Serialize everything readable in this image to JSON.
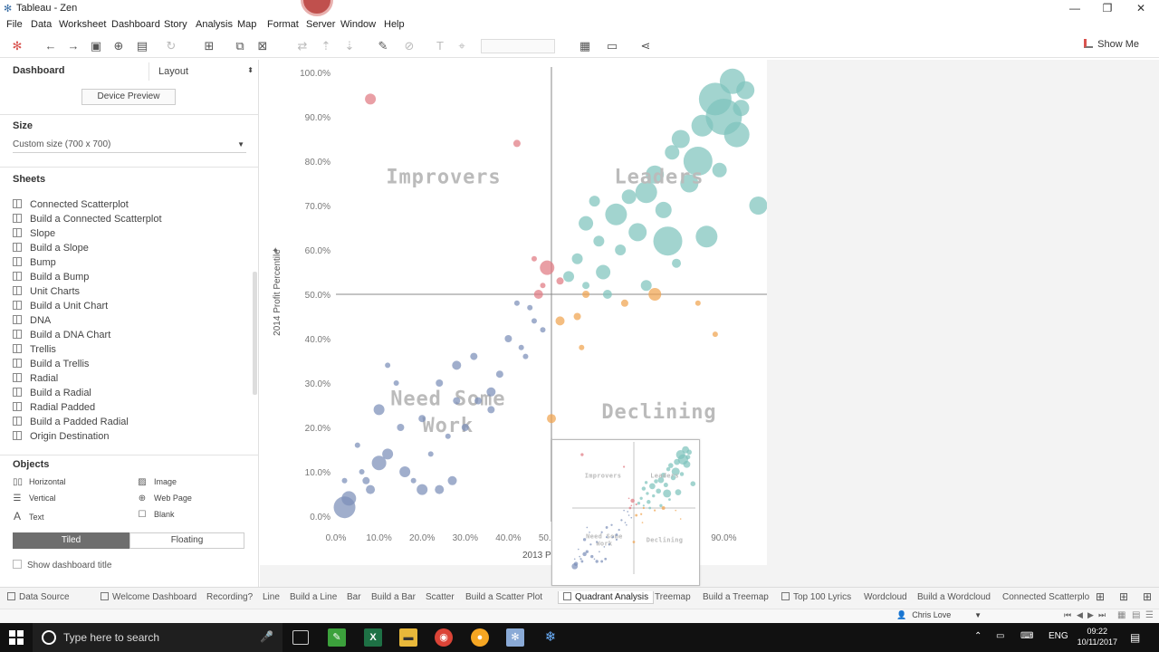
{
  "window": {
    "title": "Tableau - Zen",
    "minimize": "—",
    "restore": "❐",
    "close": "✕"
  },
  "menu": [
    "File",
    "Data",
    "Worksheet",
    "Dashboard",
    "Story",
    "Analysis",
    "Map",
    "Format",
    "Server",
    "Window",
    "Help"
  ],
  "toolbar": {
    "show_me": "Show Me"
  },
  "left_panel": {
    "tab_dashboard": "Dashboard",
    "tab_layout": "Layout",
    "device_preview": "Device Preview",
    "size_heading": "Size",
    "size_value": "Custom size (700 x 700)",
    "sheets_heading": "Sheets",
    "sheets": [
      "Connected Scatterplot",
      "Build a Connected Scatterplot",
      "Slope",
      "Build a Slope",
      "Bump",
      "Build a Bump",
      "Unit Charts",
      "Build a Unit Chart",
      "DNA",
      "Build a DNA Chart",
      "Trellis",
      "Build a Trellis",
      "Radial",
      "Build a Radial",
      "Radial Padded",
      "Build a Padded Radial",
      "Origin Destination"
    ],
    "objects_heading": "Objects",
    "objects": {
      "horizontal": "Horizontal",
      "image": "Image",
      "vertical": "Vertical",
      "web_page": "Web Page",
      "text": "Text",
      "blank": "Blank"
    },
    "tiled": "Tiled",
    "floating": "Floating",
    "show_title": "Show dashboard title"
  },
  "chart_data": {
    "type": "scatter",
    "xlabel": "2013 Profit Pe",
    "ylabel": "2014 Profit Percentile",
    "x_ticks": [
      "0.0%",
      "10.0%",
      "20.0%",
      "30.0%",
      "40.0%",
      "50.0%",
      "90.0%"
    ],
    "y_ticks": [
      "0.0%",
      "10.0%",
      "20.0%",
      "30.0%",
      "40.0%",
      "50.0%",
      "60.0%",
      "70.0%",
      "80.0%",
      "90.0%",
      "100.0%"
    ],
    "xlim": [
      0,
      100
    ],
    "ylim": [
      0,
      100
    ],
    "reference_lines": {
      "x": 50,
      "y": 50
    },
    "quadrant_labels": {
      "improvers": "Improvers",
      "leaders": "Leaders",
      "need_work": "Need Some Work",
      "declining": "Declining"
    },
    "colors": {
      "leaders": "#7ec4bd",
      "improvers": "#e07a82",
      "need_work": "#7b8fb8",
      "declining": "#f0a44f"
    },
    "series": [
      {
        "group": "leaders",
        "points": [
          [
            92,
            98,
            14
          ],
          [
            88,
            94,
            18
          ],
          [
            95,
            96,
            10
          ],
          [
            90,
            90,
            20
          ],
          [
            85,
            88,
            12
          ],
          [
            93,
            86,
            14
          ],
          [
            80,
            85,
            10
          ],
          [
            84,
            80,
            16
          ],
          [
            78,
            82,
            8
          ],
          [
            74,
            77,
            10
          ],
          [
            72,
            73,
            12
          ],
          [
            98,
            70,
            10
          ],
          [
            68,
            72,
            8
          ],
          [
            65,
            68,
            12
          ],
          [
            60,
            71,
            6
          ],
          [
            58,
            66,
            8
          ],
          [
            70,
            64,
            10
          ],
          [
            77,
            62,
            16
          ],
          [
            86,
            63,
            12
          ],
          [
            56,
            58,
            6
          ],
          [
            62,
            55,
            8
          ],
          [
            54,
            54,
            6
          ],
          [
            66,
            60,
            6
          ],
          [
            72,
            52,
            6
          ],
          [
            94,
            92,
            9
          ],
          [
            89,
            78,
            8
          ],
          [
            82,
            75,
            10
          ],
          [
            76,
            69,
            9
          ],
          [
            61,
            62,
            6
          ],
          [
            58,
            52,
            4
          ],
          [
            63,
            50,
            5
          ],
          [
            79,
            57,
            5
          ]
        ]
      },
      {
        "group": "improvers",
        "points": [
          [
            8,
            94,
            6
          ],
          [
            42,
            84,
            4
          ],
          [
            49,
            56,
            8
          ],
          [
            46,
            58,
            3
          ],
          [
            47,
            50,
            5
          ],
          [
            52,
            53,
            4
          ],
          [
            48,
            52,
            3
          ]
        ]
      },
      {
        "group": "need_work",
        "points": [
          [
            2,
            2,
            12
          ],
          [
            3,
            4,
            8
          ],
          [
            10,
            12,
            8
          ],
          [
            12,
            14,
            6
          ],
          [
            10,
            24,
            6
          ],
          [
            8,
            6,
            5
          ],
          [
            16,
            10,
            6
          ],
          [
            20,
            6,
            6
          ],
          [
            24,
            6,
            5
          ],
          [
            27,
            8,
            5
          ],
          [
            15,
            20,
            4
          ],
          [
            20,
            22,
            4
          ],
          [
            24,
            30,
            4
          ],
          [
            28,
            34,
            5
          ],
          [
            32,
            36,
            4
          ],
          [
            36,
            28,
            5
          ],
          [
            38,
            32,
            4
          ],
          [
            40,
            40,
            4
          ],
          [
            43,
            38,
            3
          ],
          [
            46,
            44,
            3
          ],
          [
            48,
            42,
            3
          ],
          [
            42,
            48,
            3
          ],
          [
            45,
            47,
            3
          ],
          [
            36,
            24,
            4
          ],
          [
            33,
            26,
            4
          ],
          [
            30,
            20,
            4
          ],
          [
            26,
            18,
            3
          ],
          [
            22,
            14,
            3
          ],
          [
            18,
            8,
            3
          ],
          [
            14,
            30,
            3
          ],
          [
            12,
            34,
            3
          ],
          [
            6,
            10,
            3
          ],
          [
            5,
            16,
            3
          ],
          [
            7,
            8,
            4
          ],
          [
            2,
            8,
            3
          ],
          [
            28,
            26,
            4
          ],
          [
            44,
            36,
            3
          ]
        ]
      },
      {
        "group": "declining",
        "points": [
          [
            50,
            22,
            5
          ],
          [
            52,
            44,
            5
          ],
          [
            56,
            45,
            4
          ],
          [
            58,
            50,
            4
          ],
          [
            67,
            48,
            4
          ],
          [
            74,
            50,
            7
          ],
          [
            84,
            48,
            3
          ],
          [
            88,
            41,
            3
          ],
          [
            57,
            38,
            3
          ]
        ]
      }
    ]
  },
  "tabs": [
    "Data Source",
    "Welcome Dashboard",
    "Recording?",
    "Line",
    "Build a Line",
    "Bar",
    "Build a Bar",
    "Scatter",
    "Build a Scatter Plot",
    "Quadrant Analysis",
    "Treemap",
    "Build a Treemap",
    "Top 100 Lyrics",
    "Wordcloud",
    "Build a Wordcloud",
    "Connected Scatterplo"
  ],
  "status": {
    "user": "Chris Love"
  },
  "taskbar": {
    "search_placeholder": "Type here to search",
    "lang": "ENG",
    "time": "09:22",
    "date": "10/11/2017"
  }
}
